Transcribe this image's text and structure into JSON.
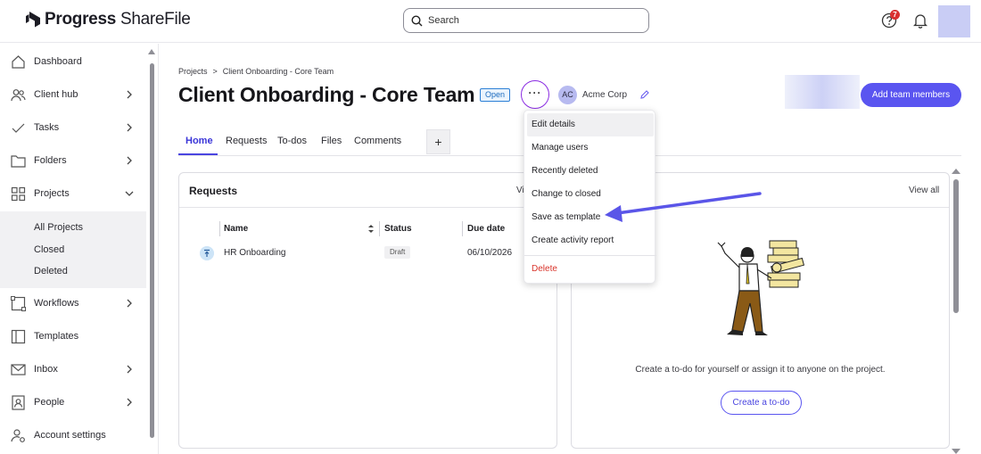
{
  "app": {
    "logo_bold": "Progress",
    "logo_light": " ShareFile",
    "search_placeholder": "Search",
    "help_badge": "7",
    "accent_color": "#5a55f0"
  },
  "sidebar": {
    "items": [
      {
        "label": "Dashboard",
        "icon": "home-icon"
      },
      {
        "label": "Client hub",
        "icon": "people-icon"
      },
      {
        "label": "Tasks",
        "icon": "check-icon"
      },
      {
        "label": "Folders",
        "icon": "folder-icon"
      },
      {
        "label": "Projects",
        "icon": "grid-icon"
      },
      {
        "label": "Workflows",
        "icon": "workflow-icon"
      },
      {
        "label": "Templates",
        "icon": "template-icon"
      },
      {
        "label": "Inbox",
        "icon": "mail-icon"
      },
      {
        "label": "People",
        "icon": "contact-icon"
      },
      {
        "label": "Account settings",
        "icon": "account-settings-icon"
      }
    ],
    "projects_sub": [
      "All Projects",
      "Closed",
      "Deleted"
    ]
  },
  "project": {
    "breadcrumb_root": "Projects",
    "breadcrumb_sep": ">",
    "breadcrumb_current": "Client Onboarding - Core Team",
    "title": "Client Onboarding - Core Team",
    "status": "Open",
    "more_label": "···",
    "client_initials": "AC",
    "client_name": "Acme Corp",
    "add_team_label": "Add team members"
  },
  "tabs": [
    {
      "label": "Home"
    },
    {
      "label": "Requests"
    },
    {
      "label": "To-dos"
    },
    {
      "label": "Files"
    },
    {
      "label": "Comments"
    }
  ],
  "tab_add": "+",
  "requests_card": {
    "title": "Requests",
    "view_all": "Vi",
    "columns": [
      "Name",
      "Status",
      "Due date"
    ],
    "rows": [
      {
        "name": "HR Onboarding",
        "status": "Draft",
        "due": "06/10/2026"
      }
    ]
  },
  "todos_card": {
    "view_all": "View all",
    "empty_text": "Create a to-do for yourself or assign it to anyone on the project.",
    "create_label": "Create a to-do"
  },
  "menu": {
    "items": [
      "Edit details",
      "Manage users",
      "Recently deleted",
      "Change to closed",
      "Save as template",
      "Create activity report"
    ],
    "delete_label": "Delete"
  }
}
